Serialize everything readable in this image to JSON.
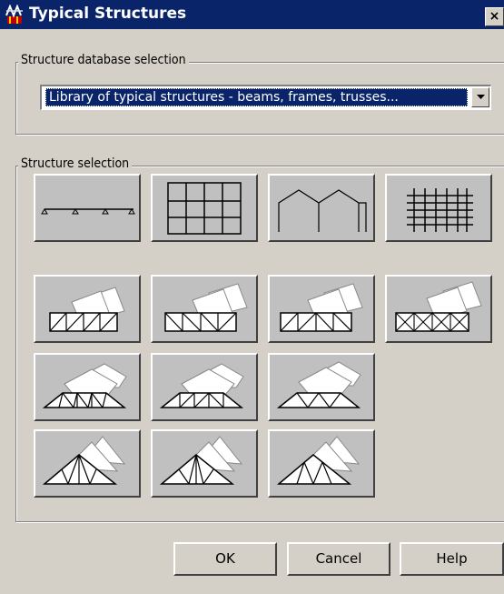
{
  "window": {
    "title": "Typical Structures",
    "close_glyph": "×"
  },
  "database_group": {
    "label": "Structure database selection",
    "selected": "Library of typical structures - beams, frames, trusses..."
  },
  "structure_group": {
    "label": "Structure selection",
    "tiles": [
      {
        "icon": "continuous-beam-icon"
      },
      {
        "icon": "plane-frame-icon"
      },
      {
        "icon": "multi-span-gable-frame-icon"
      },
      {
        "icon": "grillage-icon"
      },
      {
        "icon": "rectangular-truss-1-icon"
      },
      {
        "icon": "rectangular-truss-2-icon"
      },
      {
        "icon": "rectangular-truss-3-icon"
      },
      {
        "icon": "rectangular-truss-4-icon"
      },
      {
        "icon": "trapezoidal-truss-1-icon"
      },
      {
        "icon": "trapezoidal-truss-2-icon"
      },
      {
        "icon": "trapezoidal-truss-3-icon"
      },
      {
        "icon": "triangular-truss-1-icon"
      },
      {
        "icon": "triangular-truss-2-icon"
      },
      {
        "icon": "triangular-truss-3-icon"
      }
    ]
  },
  "buttons": {
    "ok": "OK",
    "cancel": "Cancel",
    "help": "Help"
  },
  "colors": {
    "titlebar": "#0a246a",
    "face": "#d4d0c8",
    "tile_face": "#c0c0c0",
    "selection": "#0a246a"
  }
}
